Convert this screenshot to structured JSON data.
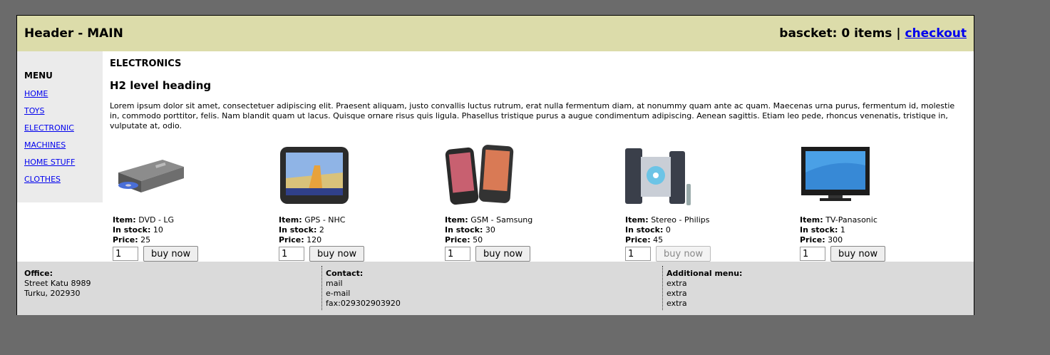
{
  "header": {
    "title": "Header - MAIN",
    "basket_text": "bascket: 0 items |",
    "checkout_label": "checkout"
  },
  "sidebar": {
    "menu_title": "MENU",
    "items": [
      {
        "label": "HOME"
      },
      {
        "label": "TOYS"
      },
      {
        "label": "ELECTRONIC"
      },
      {
        "label": "MACHINES"
      },
      {
        "label": "HOME STUFF"
      },
      {
        "label": "CLOTHES"
      }
    ]
  },
  "main": {
    "section_title": "ELECTRONICS",
    "heading": "H2 level heading",
    "paragraph": "Lorem ipsum dolor sit amet, consectetuer adipiscing elit. Praesent aliquam, justo convallis luctus rutrum, erat nulla fermentum diam, at nonummy quam ante ac quam. Maecenas urna purus, fermentum id, molestie in, commodo porttitor, felis. Nam blandit quam ut lacus. Quisque ornare risus quis ligula. Phasellus tristique purus a augue condimentum adipiscing. Aenean sagittis. Etiam leo pede, rhoncus venenatis, tristique in, vulputate at, odio."
  },
  "labels": {
    "item": "Item:",
    "stock": "In stock:",
    "price": "Price:",
    "buy": "buy now"
  },
  "products": [
    {
      "name": "DVD - LG",
      "stock": "10",
      "price": "25",
      "qty": "1",
      "icon": "dvd-player-icon",
      "buy_enabled": true
    },
    {
      "name": "GPS - NHC",
      "stock": "2",
      "price": "120",
      "qty": "1",
      "icon": "gps-device-icon",
      "buy_enabled": true
    },
    {
      "name": "GSM - Samsung",
      "stock": "30",
      "price": "50",
      "qty": "1",
      "icon": "mobile-phone-icon",
      "buy_enabled": true
    },
    {
      "name": "Stereo - Philips",
      "stock": "0",
      "price": "45",
      "qty": "1",
      "icon": "stereo-system-icon",
      "buy_enabled": false
    },
    {
      "name": "TV-Panasonic",
      "stock": "1",
      "price": "300",
      "qty": "1",
      "icon": "tv-icon",
      "buy_enabled": true
    }
  ],
  "footer": {
    "office": {
      "title": "Office:",
      "lines": [
        "Street Katu 8989",
        "Turku, 202930"
      ]
    },
    "contact": {
      "title": "Contact:",
      "lines": [
        "mail",
        "e-mail",
        "fax:029302903920"
      ]
    },
    "additional": {
      "title": "Additional menu:",
      "lines": [
        "extra",
        "extra",
        "extra"
      ]
    }
  }
}
